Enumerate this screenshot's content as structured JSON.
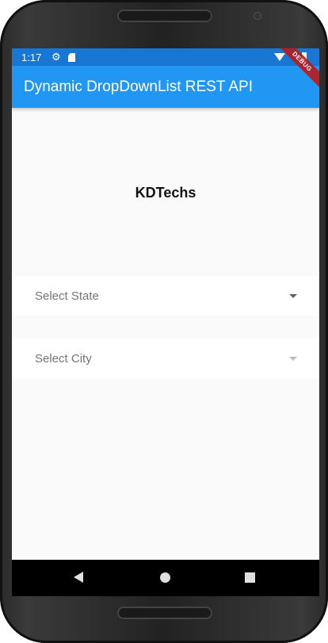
{
  "status_bar": {
    "time": "1:17",
    "icons": [
      "gear-icon",
      "sd-card-icon",
      "wifi-icon",
      "battery-icon"
    ]
  },
  "app_bar": {
    "title": "Dynamic DropDownList REST API",
    "color": "#2196f3"
  },
  "debug_banner": "DEBUG",
  "main": {
    "heading": "KDTechs",
    "state_dropdown": {
      "hint": "Select State",
      "enabled": true
    },
    "city_dropdown": {
      "hint": "Select City",
      "enabled": false
    }
  },
  "nav_bar": {
    "icons": [
      "back-icon",
      "home-icon",
      "recents-icon"
    ]
  }
}
